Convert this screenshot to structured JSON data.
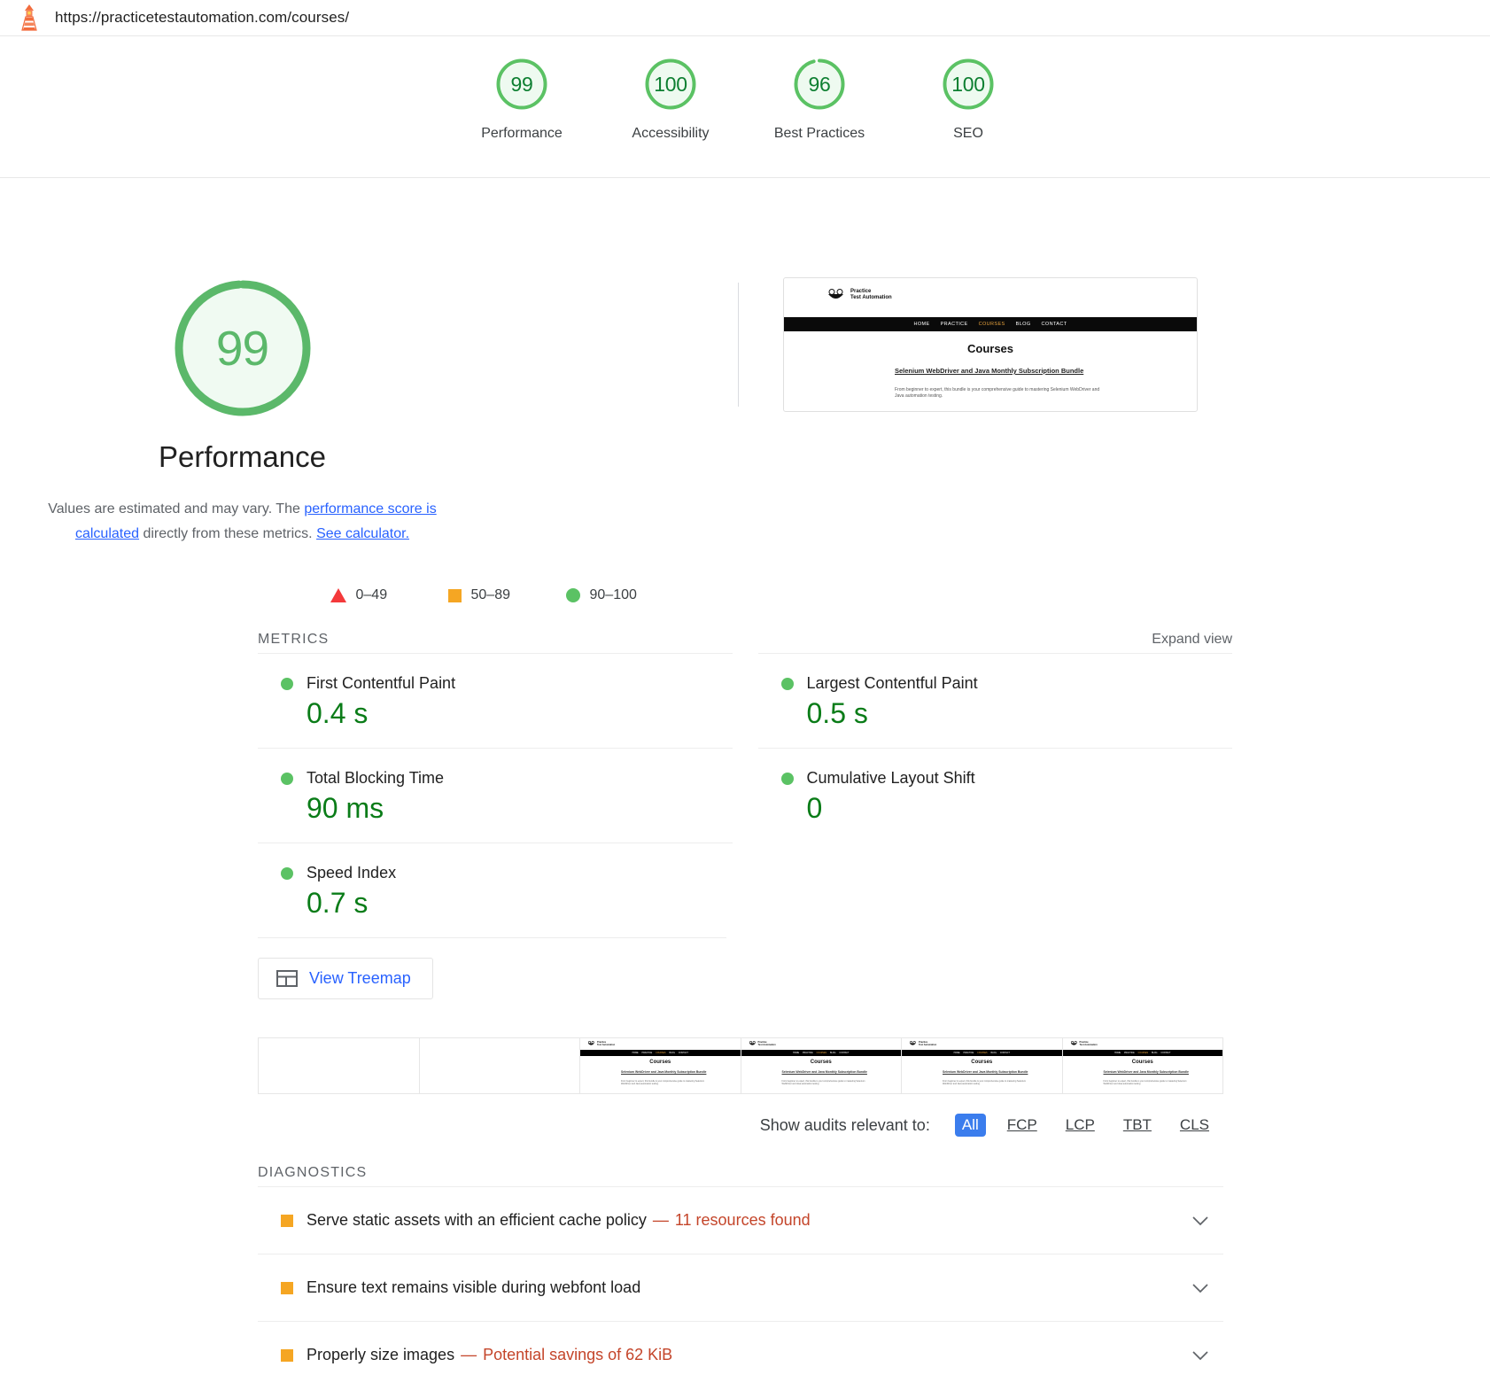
{
  "urlbar": {
    "icon": "lighthouse-icon",
    "url": "https://practicetestautomation.com/courses/"
  },
  "scores": [
    {
      "value": "99",
      "label": "Performance",
      "pct": 99
    },
    {
      "value": "100",
      "label": "Accessibility",
      "pct": 100
    },
    {
      "value": "96",
      "label": "Best Practices",
      "pct": 96
    },
    {
      "value": "100",
      "label": "SEO",
      "pct": 100
    }
  ],
  "category": {
    "score": "99",
    "title": "Performance",
    "desc_pre": "Values are estimated and may vary. The ",
    "desc_link1": "performance score is calculated",
    "desc_mid": " directly from these metrics. ",
    "desc_link2": "See calculator."
  },
  "legend": [
    {
      "shape": "triangle",
      "range": "0–49"
    },
    {
      "shape": "square",
      "range": "50–89"
    },
    {
      "shape": "circle",
      "range": "90–100"
    }
  ],
  "thumbnail": {
    "logo_line1": "Practice",
    "logo_line2": "Test Automation",
    "nav": [
      "HOME",
      "PRACTICE",
      "COURSES",
      "BLOG",
      "CONTACT"
    ],
    "active_nav": "COURSES",
    "heading": "Courses",
    "subheading": "Selenium WebDriver and Java Monthly Subscription Bundle",
    "body": "From beginner to expert, this bundle is your comprehensive guide to mastering Selenium WebDriver and Java automation testing."
  },
  "metrics_section": {
    "title": "METRICS",
    "expand_label": "Expand view",
    "left": [
      {
        "name": "First Contentful Paint",
        "value": "0.4 s",
        "status": "pass"
      },
      {
        "name": "Total Blocking Time",
        "value": "90 ms",
        "status": "pass"
      },
      {
        "name": "Speed Index",
        "value": "0.7 s",
        "status": "pass"
      }
    ],
    "right": [
      {
        "name": "Largest Contentful Paint",
        "value": "0.5 s",
        "status": "pass"
      },
      {
        "name": "Cumulative Layout Shift",
        "value": "0",
        "status": "pass"
      }
    ],
    "treemap_label": "View Treemap"
  },
  "filmstrip": {
    "frames": [
      {
        "blank": true
      },
      {
        "blank": true
      },
      {
        "blank": false
      },
      {
        "blank": false
      },
      {
        "blank": false
      },
      {
        "blank": false
      }
    ]
  },
  "audit_filter": {
    "label": "Show audits relevant to:",
    "chips": [
      {
        "label": "All",
        "active": true
      },
      {
        "label": "FCP",
        "active": false
      },
      {
        "label": "LCP",
        "active": false
      },
      {
        "label": "TBT",
        "active": false
      },
      {
        "label": "CLS",
        "active": false
      }
    ]
  },
  "diagnostics": {
    "title": "DIAGNOSTICS",
    "items": [
      {
        "title": "Serve static assets with an efficient cache policy",
        "sep": "—",
        "sub": "11 resources found"
      },
      {
        "title": "Ensure text remains visible during webfont load",
        "sep": "",
        "sub": ""
      },
      {
        "title": "Properly size images",
        "sep": "—",
        "sub": "Potential savings of 62 KiB"
      }
    ]
  },
  "colors": {
    "pass": "#5bc264",
    "average": "#f5a623",
    "fail": "#f4393b",
    "link": "#2962ff",
    "accent_blue": "#3b7ded"
  }
}
